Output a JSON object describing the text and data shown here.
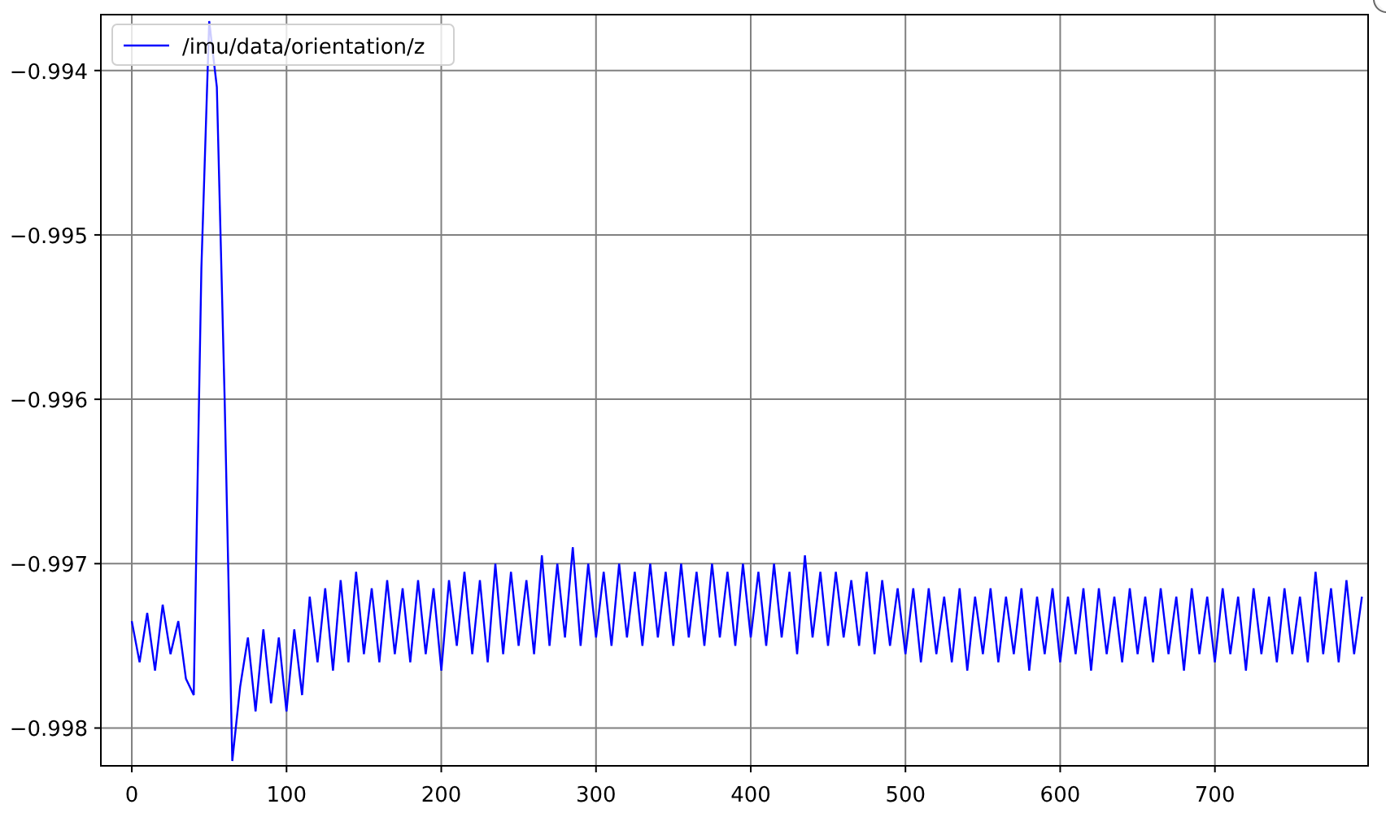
{
  "plot": {
    "chart_data": {
      "type": "line",
      "x": [
        0,
        5,
        10,
        15,
        20,
        25,
        30,
        35,
        40,
        45,
        50,
        55,
        60,
        65,
        70,
        75,
        80,
        85,
        90,
        95,
        100,
        105,
        110,
        115,
        120,
        125,
        130,
        135,
        140,
        145,
        150,
        155,
        160,
        165,
        170,
        175,
        180,
        185,
        190,
        195,
        200,
        205,
        210,
        215,
        220,
        225,
        230,
        235,
        240,
        245,
        250,
        255,
        260,
        265,
        270,
        275,
        280,
        285,
        290,
        295,
        300,
        305,
        310,
        315,
        320,
        325,
        330,
        335,
        340,
        345,
        350,
        355,
        360,
        365,
        370,
        375,
        380,
        385,
        390,
        395,
        400,
        405,
        410,
        415,
        420,
        425,
        430,
        435,
        440,
        445,
        450,
        455,
        460,
        465,
        470,
        475,
        480,
        485,
        490,
        495,
        500,
        505,
        510,
        515,
        520,
        525,
        530,
        535,
        540,
        545,
        550,
        555,
        560,
        565,
        570,
        575,
        580,
        585,
        590,
        595,
        600,
        605,
        610,
        615,
        620,
        625,
        630,
        635,
        640,
        645,
        650,
        655,
        660,
        665,
        670,
        675,
        680,
        685,
        690,
        695,
        700,
        705,
        710,
        715,
        720,
        725,
        730,
        735,
        740,
        745,
        750,
        755,
        760,
        765,
        770,
        775,
        780,
        785,
        790,
        795
      ],
      "series": [
        {
          "name": "/imu/data/orientation/z",
          "color": "#0000ff",
          "values": [
            -0.99735,
            -0.9976,
            -0.9973,
            -0.99765,
            -0.99725,
            -0.99755,
            -0.99735,
            -0.9977,
            -0.9978,
            -0.9952,
            -0.9937,
            -0.9941,
            -0.996,
            -0.9982,
            -0.99775,
            -0.99745,
            -0.9979,
            -0.9974,
            -0.99785,
            -0.99745,
            -0.9979,
            -0.9974,
            -0.9978,
            -0.9972,
            -0.9976,
            -0.99715,
            -0.99765,
            -0.9971,
            -0.9976,
            -0.99705,
            -0.99755,
            -0.99715,
            -0.9976,
            -0.9971,
            -0.99755,
            -0.99715,
            -0.9976,
            -0.9971,
            -0.99755,
            -0.99715,
            -0.99765,
            -0.9971,
            -0.9975,
            -0.99705,
            -0.99755,
            -0.9971,
            -0.9976,
            -0.997,
            -0.99755,
            -0.99705,
            -0.9975,
            -0.9971,
            -0.99755,
            -0.99695,
            -0.9975,
            -0.997,
            -0.99745,
            -0.9969,
            -0.9975,
            -0.997,
            -0.99745,
            -0.99705,
            -0.9975,
            -0.997,
            -0.99745,
            -0.99705,
            -0.9975,
            -0.997,
            -0.99745,
            -0.99705,
            -0.9975,
            -0.997,
            -0.99745,
            -0.99705,
            -0.9975,
            -0.997,
            -0.99745,
            -0.99705,
            -0.9975,
            -0.997,
            -0.99745,
            -0.99705,
            -0.9975,
            -0.997,
            -0.99745,
            -0.99705,
            -0.99755,
            -0.99695,
            -0.99745,
            -0.99705,
            -0.9975,
            -0.99705,
            -0.99745,
            -0.9971,
            -0.9975,
            -0.99705,
            -0.99755,
            -0.9971,
            -0.9975,
            -0.99715,
            -0.99755,
            -0.99715,
            -0.9976,
            -0.99715,
            -0.99755,
            -0.9972,
            -0.9976,
            -0.99715,
            -0.99765,
            -0.9972,
            -0.99755,
            -0.99715,
            -0.9976,
            -0.9972,
            -0.99755,
            -0.99715,
            -0.99765,
            -0.9972,
            -0.99755,
            -0.99715,
            -0.9976,
            -0.9972,
            -0.99755,
            -0.99715,
            -0.99765,
            -0.99715,
            -0.99755,
            -0.9972,
            -0.9976,
            -0.99715,
            -0.99755,
            -0.9972,
            -0.9976,
            -0.99715,
            -0.99755,
            -0.9972,
            -0.99765,
            -0.99715,
            -0.99755,
            -0.9972,
            -0.9976,
            -0.99715,
            -0.99755,
            -0.9972,
            -0.99765,
            -0.99715,
            -0.99755,
            -0.9972,
            -0.9976,
            -0.99715,
            -0.99755,
            -0.9972,
            -0.9976,
            -0.99705,
            -0.99755,
            -0.99715,
            -0.9976,
            -0.9971,
            -0.99755,
            -0.9972
          ]
        }
      ],
      "grid": true,
      "xlim": [
        -20,
        799
      ],
      "ylim": [
        -0.99823,
        -0.99366
      ],
      "xticks": [
        0,
        100,
        200,
        300,
        400,
        500,
        600,
        700
      ],
      "yticks": [
        {
          "value": -0.998,
          "label": "−0.998"
        },
        {
          "value": -0.997,
          "label": "−0.997"
        },
        {
          "value": -0.996,
          "label": "−0.996"
        },
        {
          "value": -0.995,
          "label": "−0.995"
        },
        {
          "value": -0.994,
          "label": "−0.994"
        }
      ]
    }
  }
}
